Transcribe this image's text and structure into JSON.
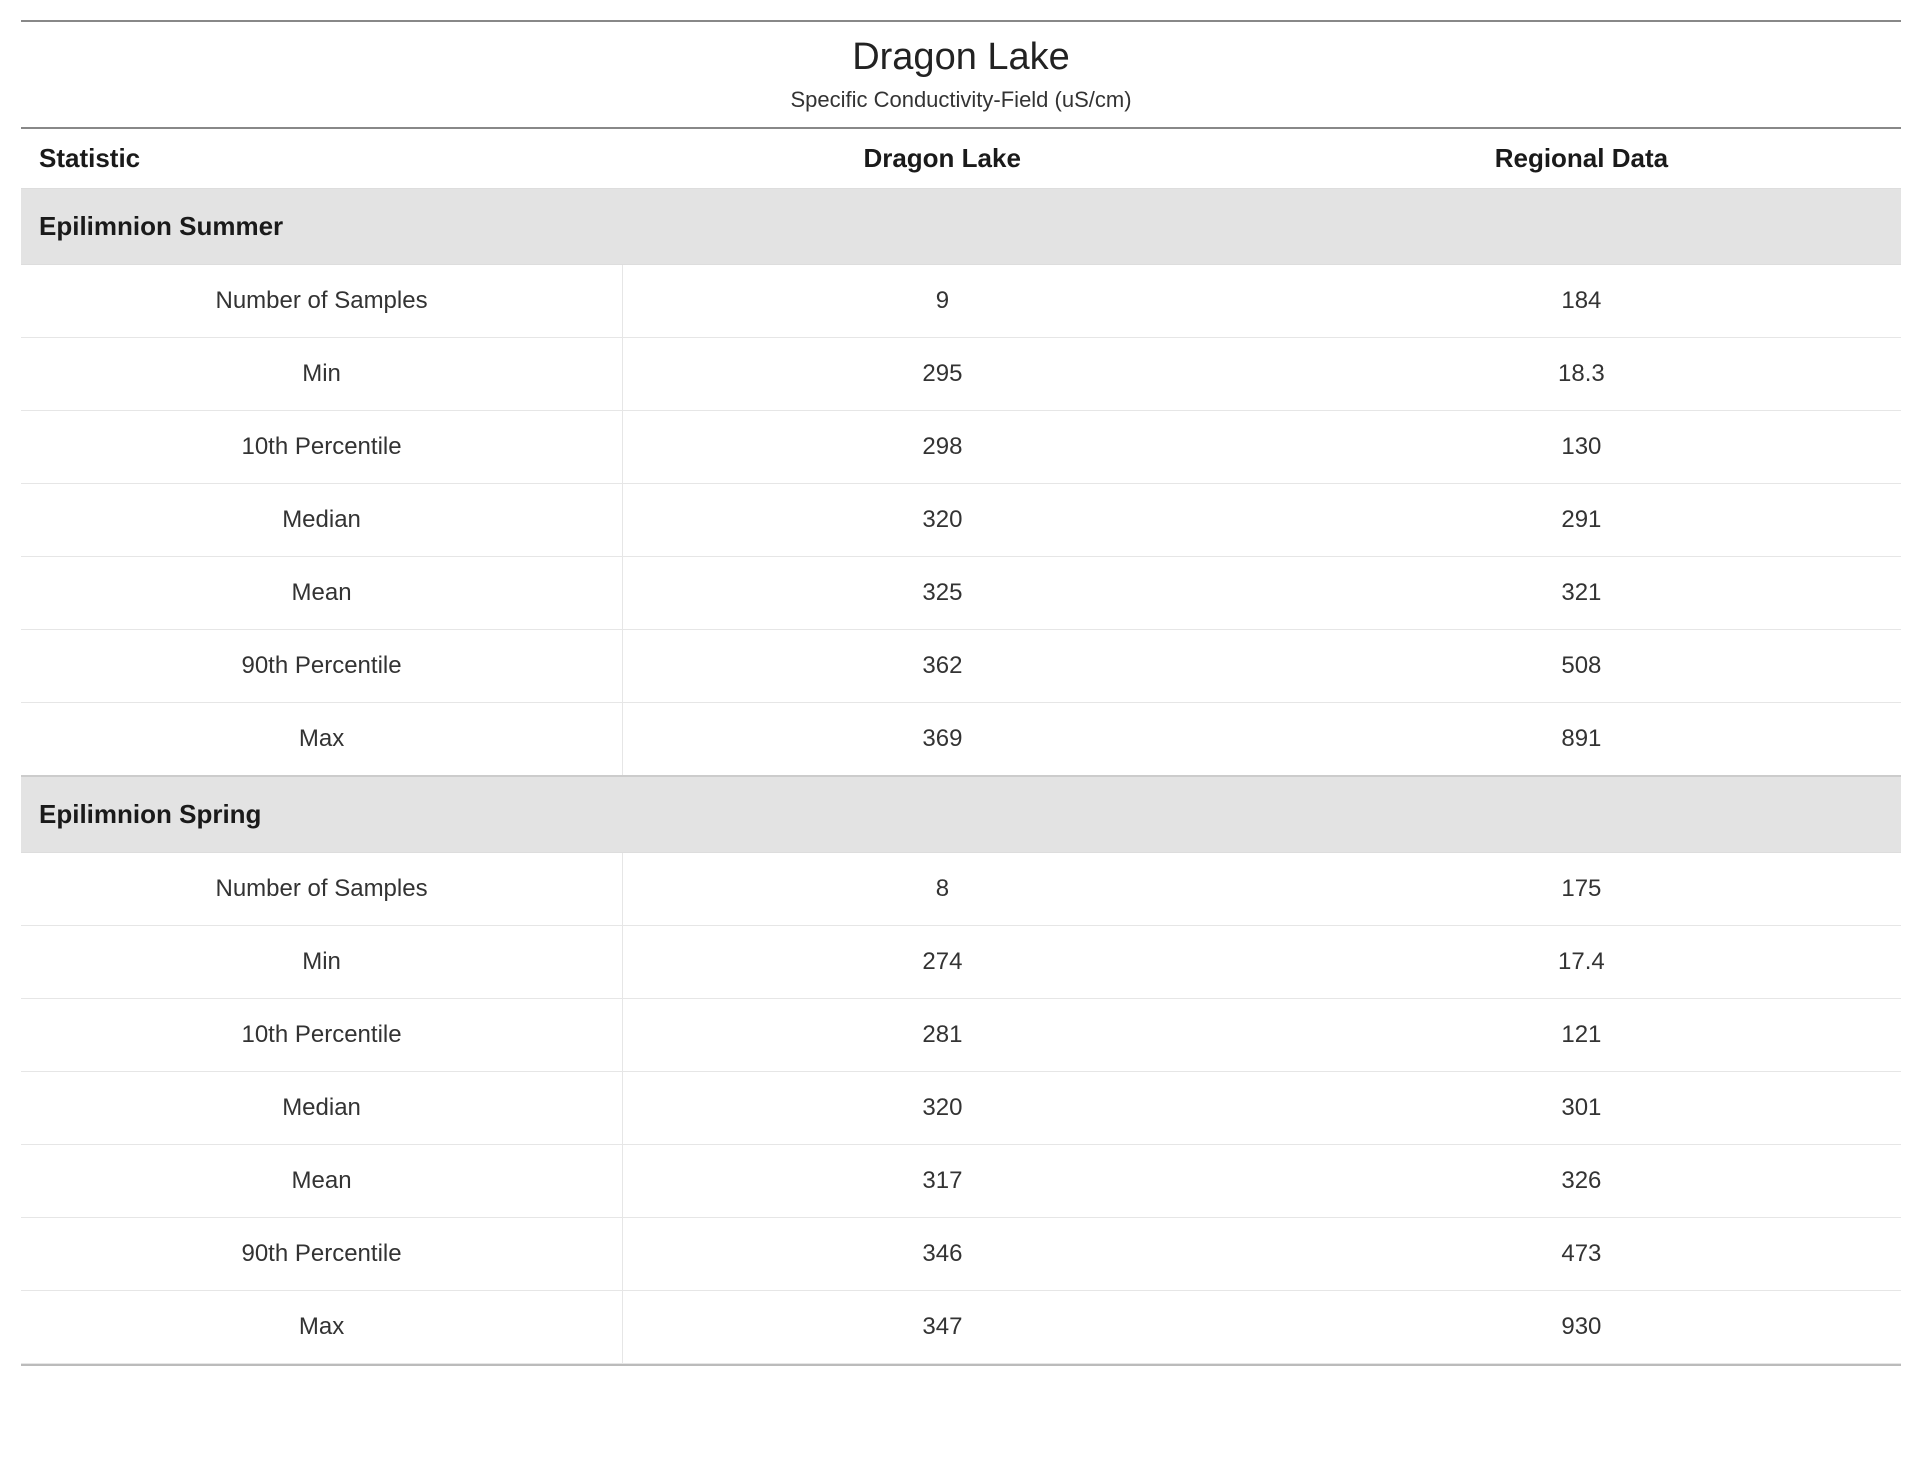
{
  "header": {
    "title": "Dragon Lake",
    "subtitle": "Specific Conductivity-Field (uS/cm)"
  },
  "columns": {
    "stat": "Statistic",
    "site": "Dragon Lake",
    "regional": "Regional Data"
  },
  "sections": [
    {
      "name": "Epilimnion Summer",
      "rows": [
        {
          "stat": "Number of Samples",
          "site": "9",
          "regional": "184"
        },
        {
          "stat": "Min",
          "site": "295",
          "regional": "18.3"
        },
        {
          "stat": "10th Percentile",
          "site": "298",
          "regional": "130"
        },
        {
          "stat": "Median",
          "site": "320",
          "regional": "291"
        },
        {
          "stat": "Mean",
          "site": "325",
          "regional": "321"
        },
        {
          "stat": "90th Percentile",
          "site": "362",
          "regional": "508"
        },
        {
          "stat": "Max",
          "site": "369",
          "regional": "891"
        }
      ]
    },
    {
      "name": "Epilimnion Spring",
      "rows": [
        {
          "stat": "Number of Samples",
          "site": "8",
          "regional": "175"
        },
        {
          "stat": "Min",
          "site": "274",
          "regional": "17.4"
        },
        {
          "stat": "10th Percentile",
          "site": "281",
          "regional": "121"
        },
        {
          "stat": "Median",
          "site": "320",
          "regional": "301"
        },
        {
          "stat": "Mean",
          "site": "317",
          "regional": "326"
        },
        {
          "stat": "90th Percentile",
          "site": "346",
          "regional": "473"
        },
        {
          "stat": "Max",
          "site": "347",
          "regional": "930"
        }
      ]
    }
  ]
}
